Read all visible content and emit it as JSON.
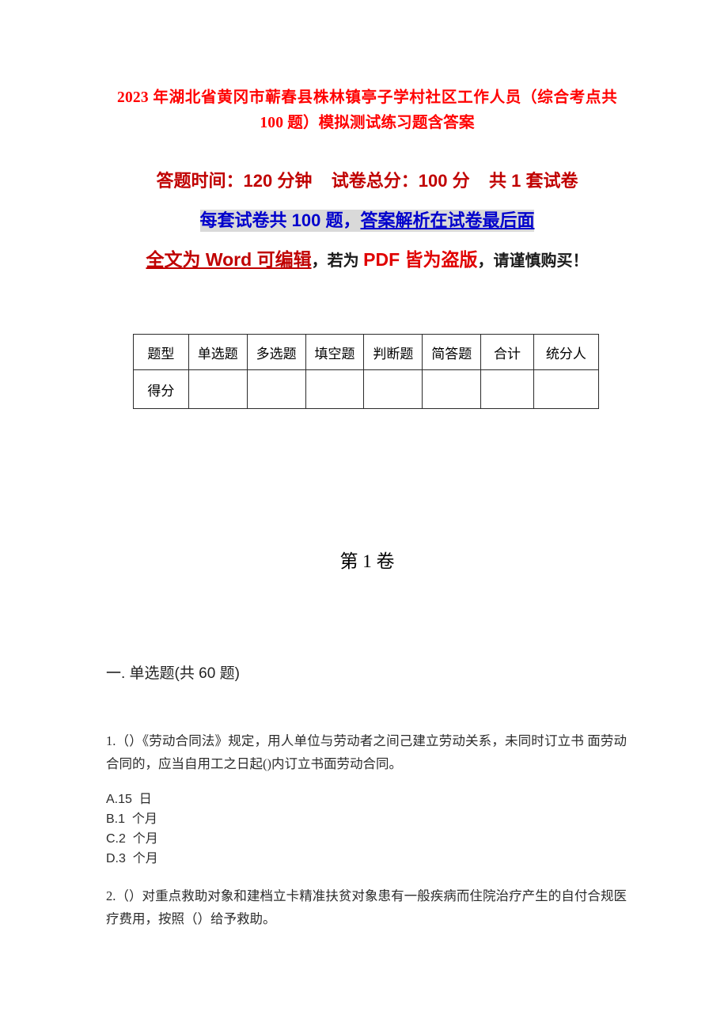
{
  "document": {
    "title": "2023 年湖北省黄冈市蕲春县株林镇亭子学村社区工作人员（综合考点共 100 题）模拟测试练习题含答案",
    "exam_info_line": "答题时间：120 分钟    试卷总分：100 分    共 1 套试卷",
    "highlight_line": {
      "part1": "每套试卷共 100 题，",
      "part2": "答案解析在试卷最后面"
    },
    "piracy_notice": {
      "part1": "全文为 Word 可编辑",
      "part2": "，若为 ",
      "part3": "PDF 皆为盗版",
      "part4": "，请谨慎购买！"
    },
    "volume_heading": "第 1 卷",
    "section_heading": "一. 单选题(共 60 题)"
  },
  "score_table": {
    "headers": [
      "题型",
      "单选题",
      "多选题",
      "填空题",
      "判断题",
      "简答题",
      "合计",
      "统分人"
    ],
    "rows": [
      {
        "label": "得分",
        "cells": [
          "",
          "",
          "",
          "",
          "",
          "",
          ""
        ]
      }
    ]
  },
  "questions": [
    {
      "number": "1.",
      "text": "1.（）《劳动合同法》规定，用人单位与劳动者之间己建立劳动关系，未同时订立书 面劳动合同的，应当自用工之日起()内订立书面劳动合同。",
      "options": [
        "A.15  日",
        "B.1  个月",
        "C.2  个月",
        "D.3  个月"
      ]
    },
    {
      "number": "2.",
      "text": "2.（）对重点救助对象和建档立卡精准扶贫对象患有一般疾病而住院治疗产生的自付合规医疗费用，按照（）给予救助。",
      "options": []
    }
  ],
  "colors": {
    "title_red": "#FF0000",
    "subtitle_dark_red": "#C00000",
    "highlight_blue": "#0000CC",
    "highlight_bg": "#D9D9D9",
    "bright_red": "#E00000",
    "body_text": "#2b2b2b",
    "table_border": "#2b2b2b",
    "page_bg": "#ffffff"
  }
}
